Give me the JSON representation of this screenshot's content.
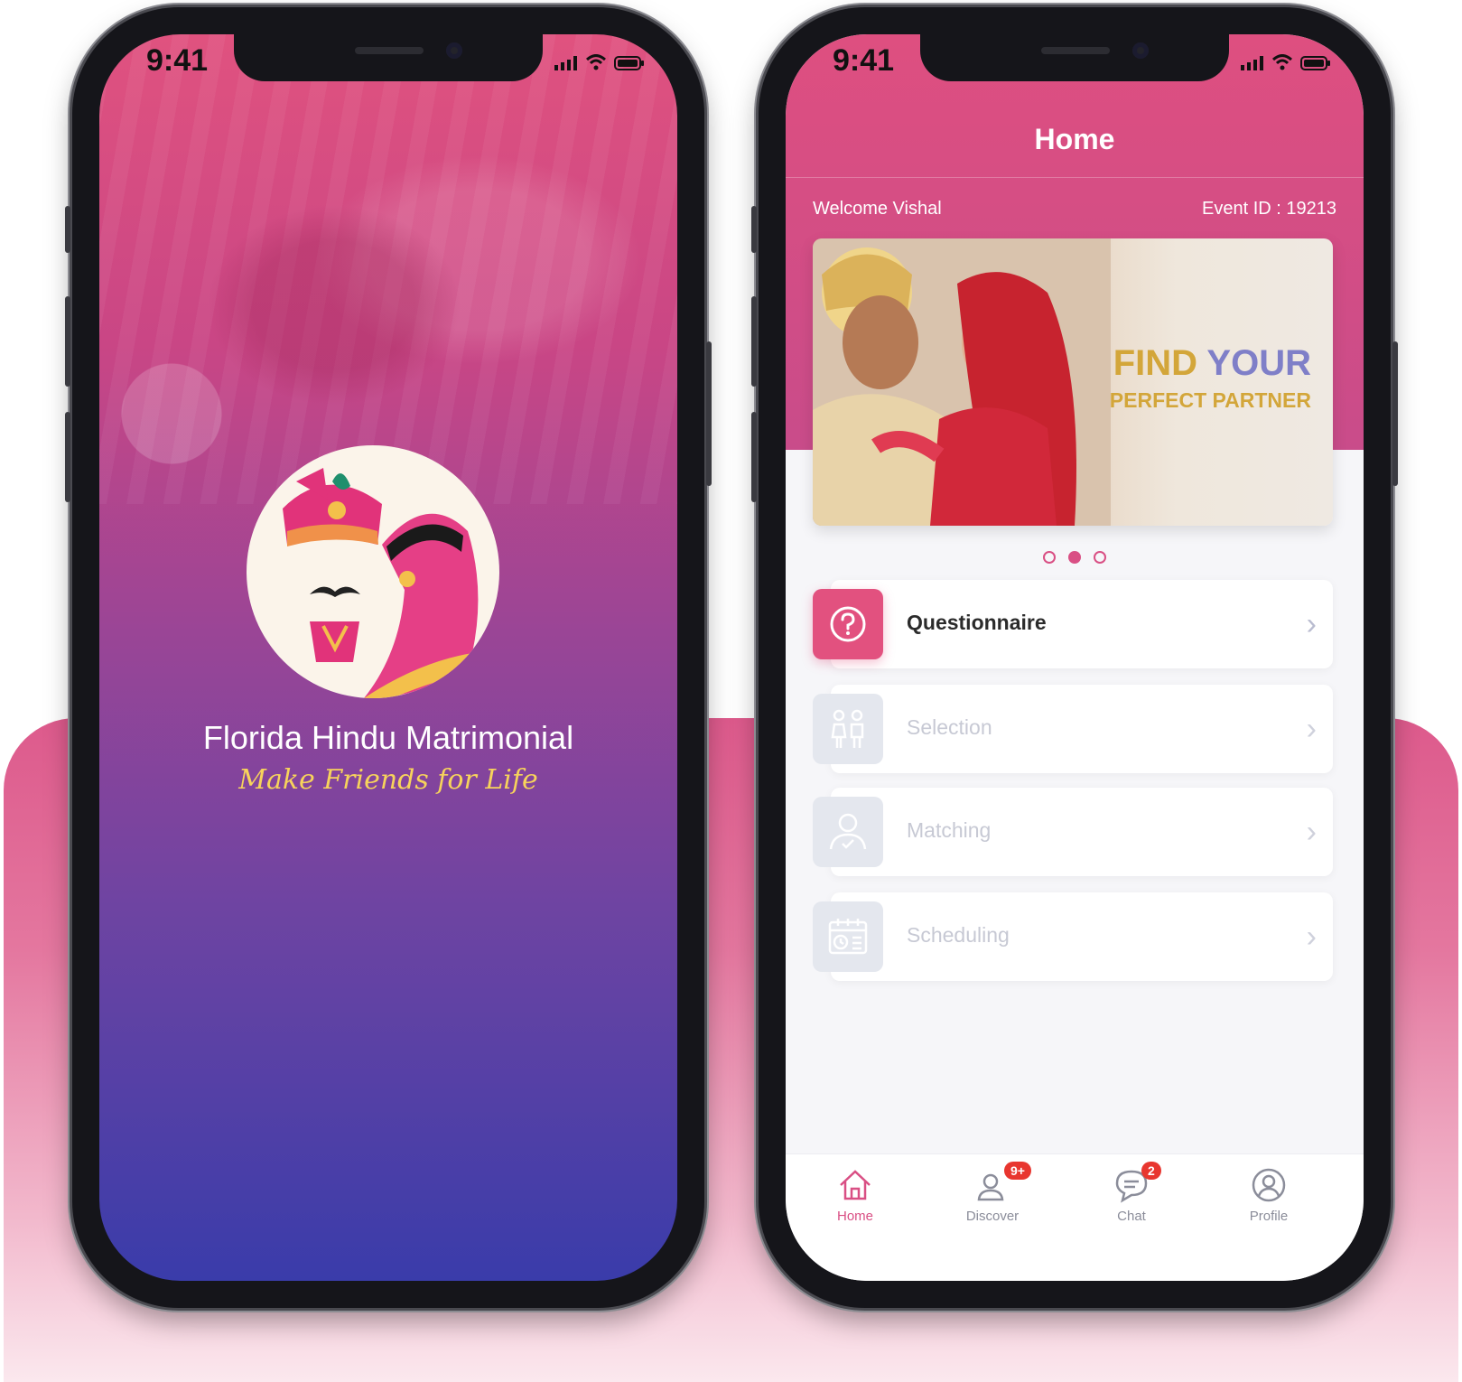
{
  "colors": {
    "brand_pink": "#de4f80",
    "splash_bottom": "#3a3caa",
    "gold": "#d3a63a",
    "banner_blue": "#7f7fc8",
    "badge_red": "#e8362f"
  },
  "status_bar": {
    "time": "9:41"
  },
  "splash": {
    "title": "Florida Hindu Matrimonial",
    "tagline": "Make Friends for Life"
  },
  "home": {
    "title": "Home",
    "welcome": "Welcome Vishal",
    "event_id": "Event ID : 19213",
    "banner": {
      "line1_a": "FIND",
      "line1_b": "YOUR",
      "line2": "PERFECT PARTNER",
      "slides": 3,
      "active_slide": 2
    },
    "menu": [
      {
        "label": "Questionnaire",
        "icon": "question-icon",
        "enabled": true
      },
      {
        "label": "Selection",
        "icon": "couple-icon",
        "enabled": false
      },
      {
        "label": "Matching",
        "icon": "user-check-icon",
        "enabled": false
      },
      {
        "label": "Scheduling",
        "icon": "calendar-icon",
        "enabled": false
      }
    ],
    "tabs": [
      {
        "label": "Home",
        "icon": "home-icon",
        "active": true,
        "badge": ""
      },
      {
        "label": "Discover",
        "icon": "discover-icon",
        "active": false,
        "badge": "9+"
      },
      {
        "label": "Chat",
        "icon": "chat-icon",
        "active": false,
        "badge": "2"
      },
      {
        "label": "Profile",
        "icon": "profile-icon",
        "active": false,
        "badge": ""
      }
    ]
  }
}
